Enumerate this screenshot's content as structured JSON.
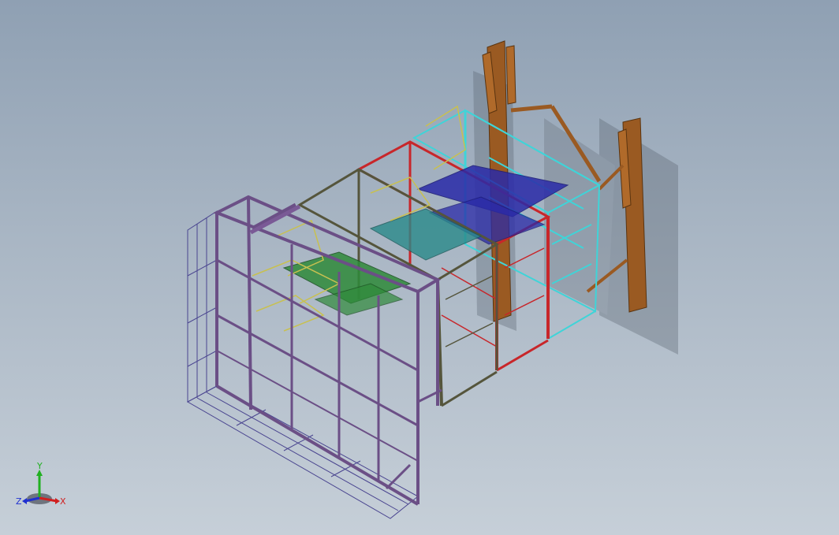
{
  "viewport": {
    "background_top": "#8fa0b3",
    "background_bottom": "#c6cfd8"
  },
  "model": {
    "frame_colors": {
      "front_frame": "#6b4f86",
      "outer_mesh": "#4a4590",
      "stage_olive": "#55553c",
      "stage_red": "#c8262a",
      "stage_cyan": "#3fd4d8",
      "rear_posts": "#9a5a22",
      "inner_green": "#2f8a3a",
      "inner_blue": "#2a2aa8",
      "inner_teal": "#2a8a8a",
      "ladder_yellow": "#c8c050"
    }
  },
  "triad": {
    "x_label": "X",
    "y_label": "Y",
    "z_label": "Z",
    "x_color": "#d02020",
    "y_color": "#20b020",
    "z_color": "#2030d0"
  }
}
